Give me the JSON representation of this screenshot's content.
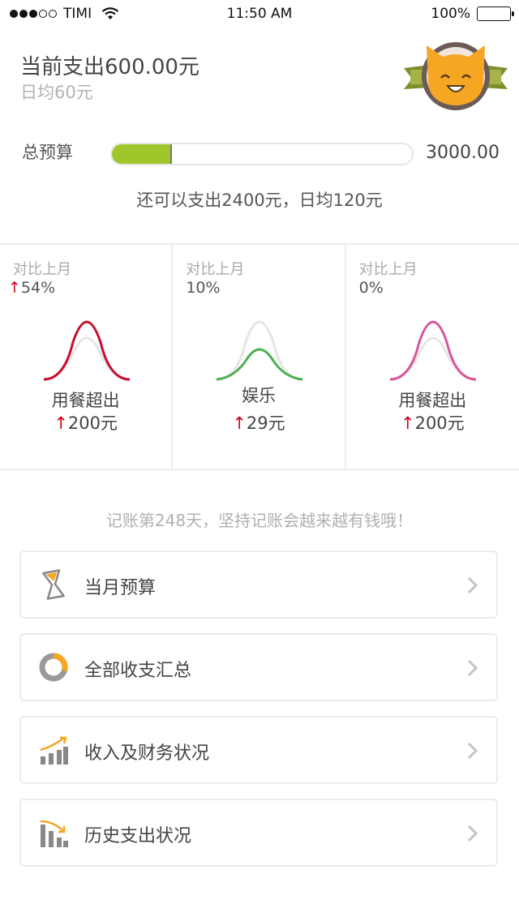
{
  "status_bar": {
    "carrier": "TIMI",
    "time": "11:50 AM",
    "battery": "100%",
    "signal_bars": 3
  },
  "summary": {
    "spent_title": "当前支出600.00元",
    "daily_average": "日均60元"
  },
  "budget": {
    "label": "总预算",
    "total": "3000.00",
    "progress_fraction": 0.2,
    "remaining_text": "还可以支出2400元，日均120元",
    "fill_color": "#a0c62b"
  },
  "compare_cards": [
    {
      "label": "对比上月",
      "change": "54%",
      "arrow": "↑",
      "category": "用餐超出",
      "amount": "200元",
      "curve_color": "#c8102e"
    },
    {
      "label": "对比上月",
      "change": "10%",
      "arrow": "",
      "category": "娱乐",
      "amount": "29元",
      "curve_color": "#4caf50"
    },
    {
      "label": "对比上月",
      "change": "0%",
      "arrow": "",
      "category": "用餐超出",
      "amount": "200元",
      "curve_color": "#d9579a"
    }
  ],
  "slogan": "记账第248天，坚持记账会越来越有钱哦！",
  "menu": [
    {
      "label": "当月预算",
      "icon": "hourglass-icon"
    },
    {
      "label": "全部收支汇总",
      "icon": "donut-chart-icon"
    },
    {
      "label": "收入及财务状况",
      "icon": "rising-bars-icon"
    },
    {
      "label": "历史支出状况",
      "icon": "falling-bars-icon"
    }
  ],
  "colors": {
    "accent_green": "#a0c62b",
    "mascot_orange": "#f5a623",
    "arrow_red": "#d0021b"
  }
}
